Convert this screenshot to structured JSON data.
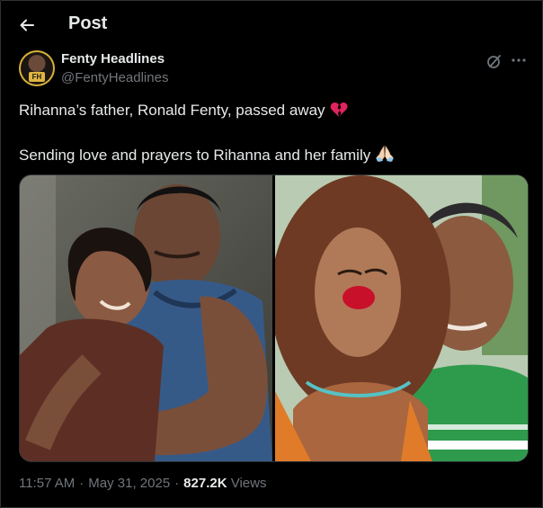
{
  "header": {
    "title": "Post"
  },
  "author": {
    "name": "Fenty Headlines",
    "handle": "@FentyHeadlines",
    "avatar_badge": "FH"
  },
  "tweet": {
    "line1": "Rihanna’s father, Ronald Fenty, passed away",
    "line1_emoji": "broken-heart-icon",
    "line2": "Sending love and prayers to Rihanna and her family",
    "line2_emoji": "folded-hands-icon"
  },
  "meta": {
    "time": "11:57 AM",
    "date": "May 31, 2025",
    "views_count": "827.2K",
    "views_label": "Views"
  },
  "colors": {
    "background": "#000000",
    "text": "#e7e9ea",
    "secondary": "#71767b",
    "border": "#2f3336",
    "heart": "#e0245e"
  }
}
